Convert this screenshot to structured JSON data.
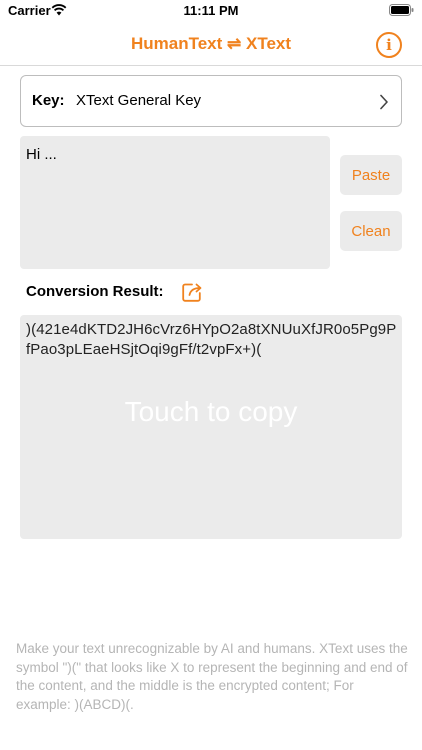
{
  "status_bar": {
    "carrier": "Carrier",
    "time": "11:11 PM"
  },
  "nav": {
    "title": "HumanText ⇌ XText",
    "info_icon": "info-icon",
    "accent_color": "#f0821e"
  },
  "key": {
    "label": "Key:",
    "value": "XText General Key"
  },
  "input": {
    "value": "Hi ..."
  },
  "buttons": {
    "paste": "Paste",
    "clean": "Clean"
  },
  "result": {
    "label": "Conversion Result:",
    "text": ")(421e4dKTD2JH6cVrz6HYpO2a8tXNUuXfJR0o5Pg9PfPao3pLEaeHSjtOqi9gFf/t2vpFx+)(",
    "hint": "Touch to copy"
  },
  "footer": {
    "note": "Make your text unrecognizable by AI and humans. XText uses the symbol \")(\" that looks like X to represent the beginning and end of the content, and the middle is the encrypted content; For example: )(ABCD)(."
  }
}
